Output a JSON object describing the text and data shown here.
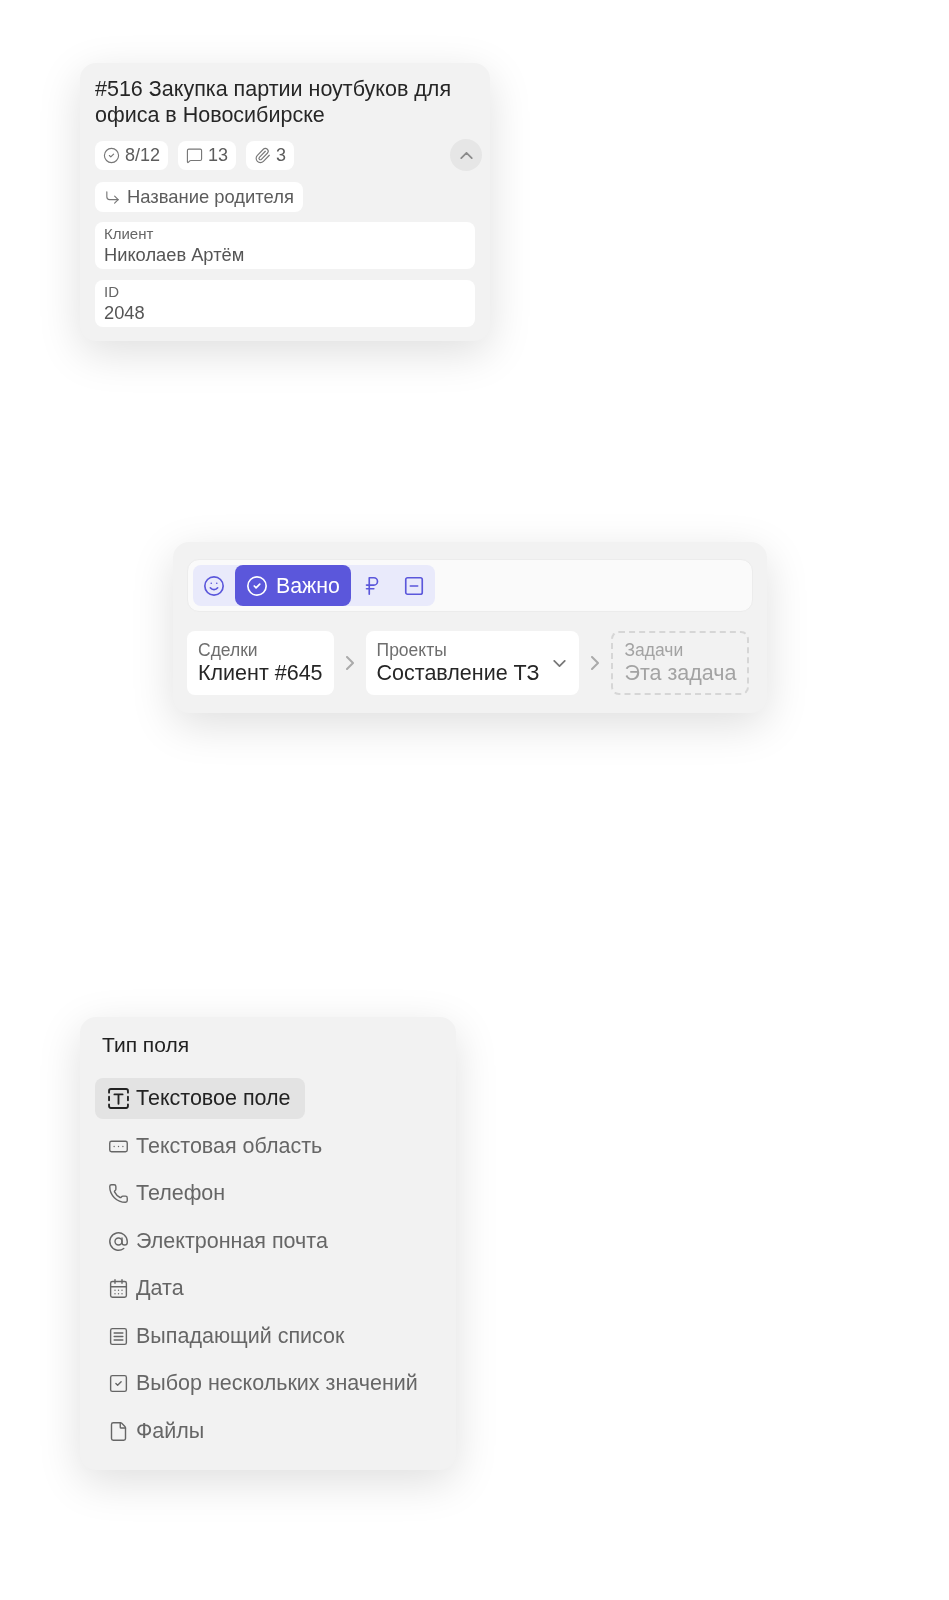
{
  "task_card": {
    "title": "#516 Закупка партии ноутбуков для офиса в Новосибирске",
    "counters": [
      {
        "kind": "subtasks",
        "value": "8/12"
      },
      {
        "kind": "comments",
        "value": "13"
      },
      {
        "kind": "attachments",
        "value": "3"
      }
    ],
    "expanded": true,
    "parent": "Название родителя",
    "fields": [
      {
        "label": "Клиент",
        "value": "Николаев Артём"
      },
      {
        "label": "ID",
        "value": "2048"
      }
    ]
  },
  "tag_editor": {
    "tags": [
      {
        "kind": "emoji",
        "selected": false
      },
      {
        "kind": "important",
        "label": "Важно",
        "selected": true
      },
      {
        "kind": "currency",
        "selected": false
      },
      {
        "kind": "minus",
        "selected": false
      }
    ],
    "breadcrumbs": [
      {
        "kind": "filled",
        "label": "Сделки",
        "value": "Клиент #645"
      },
      {
        "kind": "dropdown",
        "label": "Проекты",
        "value": "Составление ТЗ"
      },
      {
        "kind": "placeholder",
        "label": "Задачи",
        "value": "Эта задача"
      }
    ]
  },
  "field_type_menu": {
    "title": "Тип поля",
    "items": [
      {
        "kind": "text",
        "label": "Текстовое поле",
        "selected": true
      },
      {
        "kind": "textarea",
        "label": "Текстовая область",
        "selected": false
      },
      {
        "kind": "phone",
        "label": "Телефон",
        "selected": false
      },
      {
        "kind": "email",
        "label": "Электронная почта",
        "selected": false
      },
      {
        "kind": "date",
        "label": "Дата",
        "selected": false
      },
      {
        "kind": "select",
        "label": "Выпадающий список",
        "selected": false
      },
      {
        "kind": "multiselect",
        "label": "Выбор нескольких значений",
        "selected": false
      },
      {
        "kind": "files",
        "label": "Файлы",
        "selected": false
      }
    ]
  }
}
